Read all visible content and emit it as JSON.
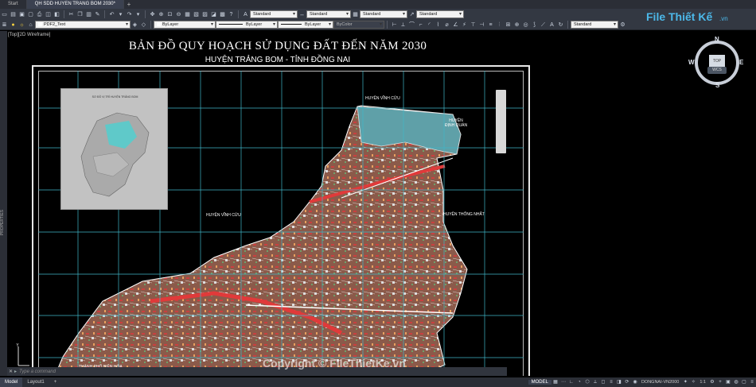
{
  "tabs": [
    {
      "label": "Start",
      "active": false
    },
    {
      "label": "QH SDD HUYEN TRANG BOM 2030*",
      "active": true
    }
  ],
  "toolbar": {
    "text_style": "Standard",
    "dim_style": "Standard",
    "table_style": "Standard",
    "mleader_style": "Standard",
    "layer": "PDF2_Text",
    "color": "ByLayer",
    "linetype": "ByLayer",
    "lineweight": "ByLayer",
    "plot_style": "ByColor",
    "visual_style": "Standard"
  },
  "viewport": {
    "label": "[Top][2D Wireframe]",
    "map_title": "BẢN ĐỒ QUY HOẠCH SỬ DỤNG ĐẤT ĐẾN NĂM 2030",
    "map_subtitle": "HUYỆN TRẢNG BOM - TỈNH ĐỒNG NAI",
    "inset_title": "SƠ ĐỒ VỊ TRÍ HUYỆN TRẢNG BOM",
    "labels": {
      "vinh_cuu_top": "HUYỆN VĨNH CỬU",
      "dinh_quan": "HUYỆN\nĐỊNH QUÁN",
      "vinh_cuu_left": "HUYỆN VĨNH CỬU",
      "thong_nhat": "HUYỆN THỐNG NHẤT",
      "bien_hoa": "THÀNH PHỐ BIÊN HÒA"
    }
  },
  "compass": {
    "n": "N",
    "s": "S",
    "e": "E",
    "w": "W",
    "top": "TOP",
    "wcs": "WCS"
  },
  "properties_label": "PROPERTIES",
  "command_line": {
    "placeholder": "Type a command"
  },
  "watermark": "Copyright © FileThietKe.vn",
  "logo": {
    "text": "File Thiết Kế",
    "domain": ".vn"
  },
  "status": {
    "layout_tabs": [
      {
        "label": "Model",
        "active": true
      },
      {
        "label": "Layout1",
        "active": false
      }
    ],
    "model_button": "MODEL",
    "coord_system": "DONGNAI-VN2000",
    "scale": "1:1"
  },
  "colors": {
    "canvas": "#000000",
    "grid": "#3fb6c8",
    "land_brown": "#8b5a4a",
    "land_red": "#e03a3a",
    "water_teal": "#5fa0a8",
    "logo": "#4cb8e9"
  }
}
